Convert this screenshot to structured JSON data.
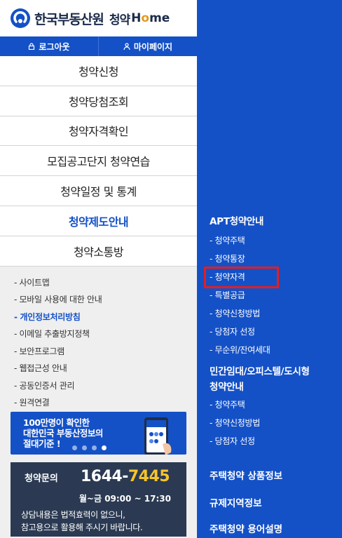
{
  "header": {
    "logo_text": "한국부동산원",
    "logo_sub": "청약",
    "logo_home_prefix": "H",
    "logo_home_o": "o",
    "logo_home_suffix": "me"
  },
  "user_bar": {
    "logout_label": "로그아웃",
    "mypage_label": "마이페이지"
  },
  "main_menu": [
    {
      "label": "청약신청"
    },
    {
      "label": "청약당첨조회"
    },
    {
      "label": "청약자격확인"
    },
    {
      "label": "모집공고단지 청약연습"
    },
    {
      "label": "청약일정 및 통계"
    },
    {
      "label": "청약제도안내"
    },
    {
      "label": "청약소통방"
    }
  ],
  "sub_links": [
    {
      "label": "- 사이트맵"
    },
    {
      "label": "- 모바일 사용에 대한 안내"
    },
    {
      "label": "- 개인정보처리방침"
    },
    {
      "label": "- 이메일 추출방지정책"
    },
    {
      "label": "- 보안프로그램"
    },
    {
      "label": "- 웹접근성 안내"
    },
    {
      "label": "- 공동인증서 관리"
    },
    {
      "label": "- 원격연결"
    }
  ],
  "banner": {
    "line1": "100만명이 확인한",
    "line2": "대한민국 부동산정보의",
    "line3": "절대기준 !"
  },
  "contact": {
    "label": "청약문의",
    "phone_prefix": "1644-",
    "phone_suffix": "7445",
    "hours": "월~금 09:00 ~ 17:30",
    "note_line1": "상담내용은 법적효력이 없으니,",
    "note_line2": "참고용으로 활용해 주시기 바랍니다."
  },
  "submenu": {
    "section1_title": "APT청약안내",
    "section1_items": [
      {
        "label": "- 청약주택"
      },
      {
        "label": "- 청약통장"
      },
      {
        "label": "- 청약자격"
      },
      {
        "label": "- 특별공급"
      },
      {
        "label": "- 청약신청방법"
      },
      {
        "label": "- 당첨자 선정"
      },
      {
        "label": "- 무순위/잔여세대"
      }
    ],
    "section2_title_line1": "민간임대/오피스텔/도시형",
    "section2_title_line2": "청약안내",
    "section2_items": [
      {
        "label": "- 청약주택"
      },
      {
        "label": "- 청약신청방법"
      },
      {
        "label": "- 당첨자 선정"
      }
    ],
    "link_product": "주택청약 상품정보",
    "link_region": "규제지역정보",
    "link_terms": "주택청약 용어설명"
  },
  "colors": {
    "brand_blue": "#1451c7",
    "highlight_red": "#e81c1c",
    "phone_accent": "#f6c52b",
    "contact_bg": "#2b3a52"
  }
}
